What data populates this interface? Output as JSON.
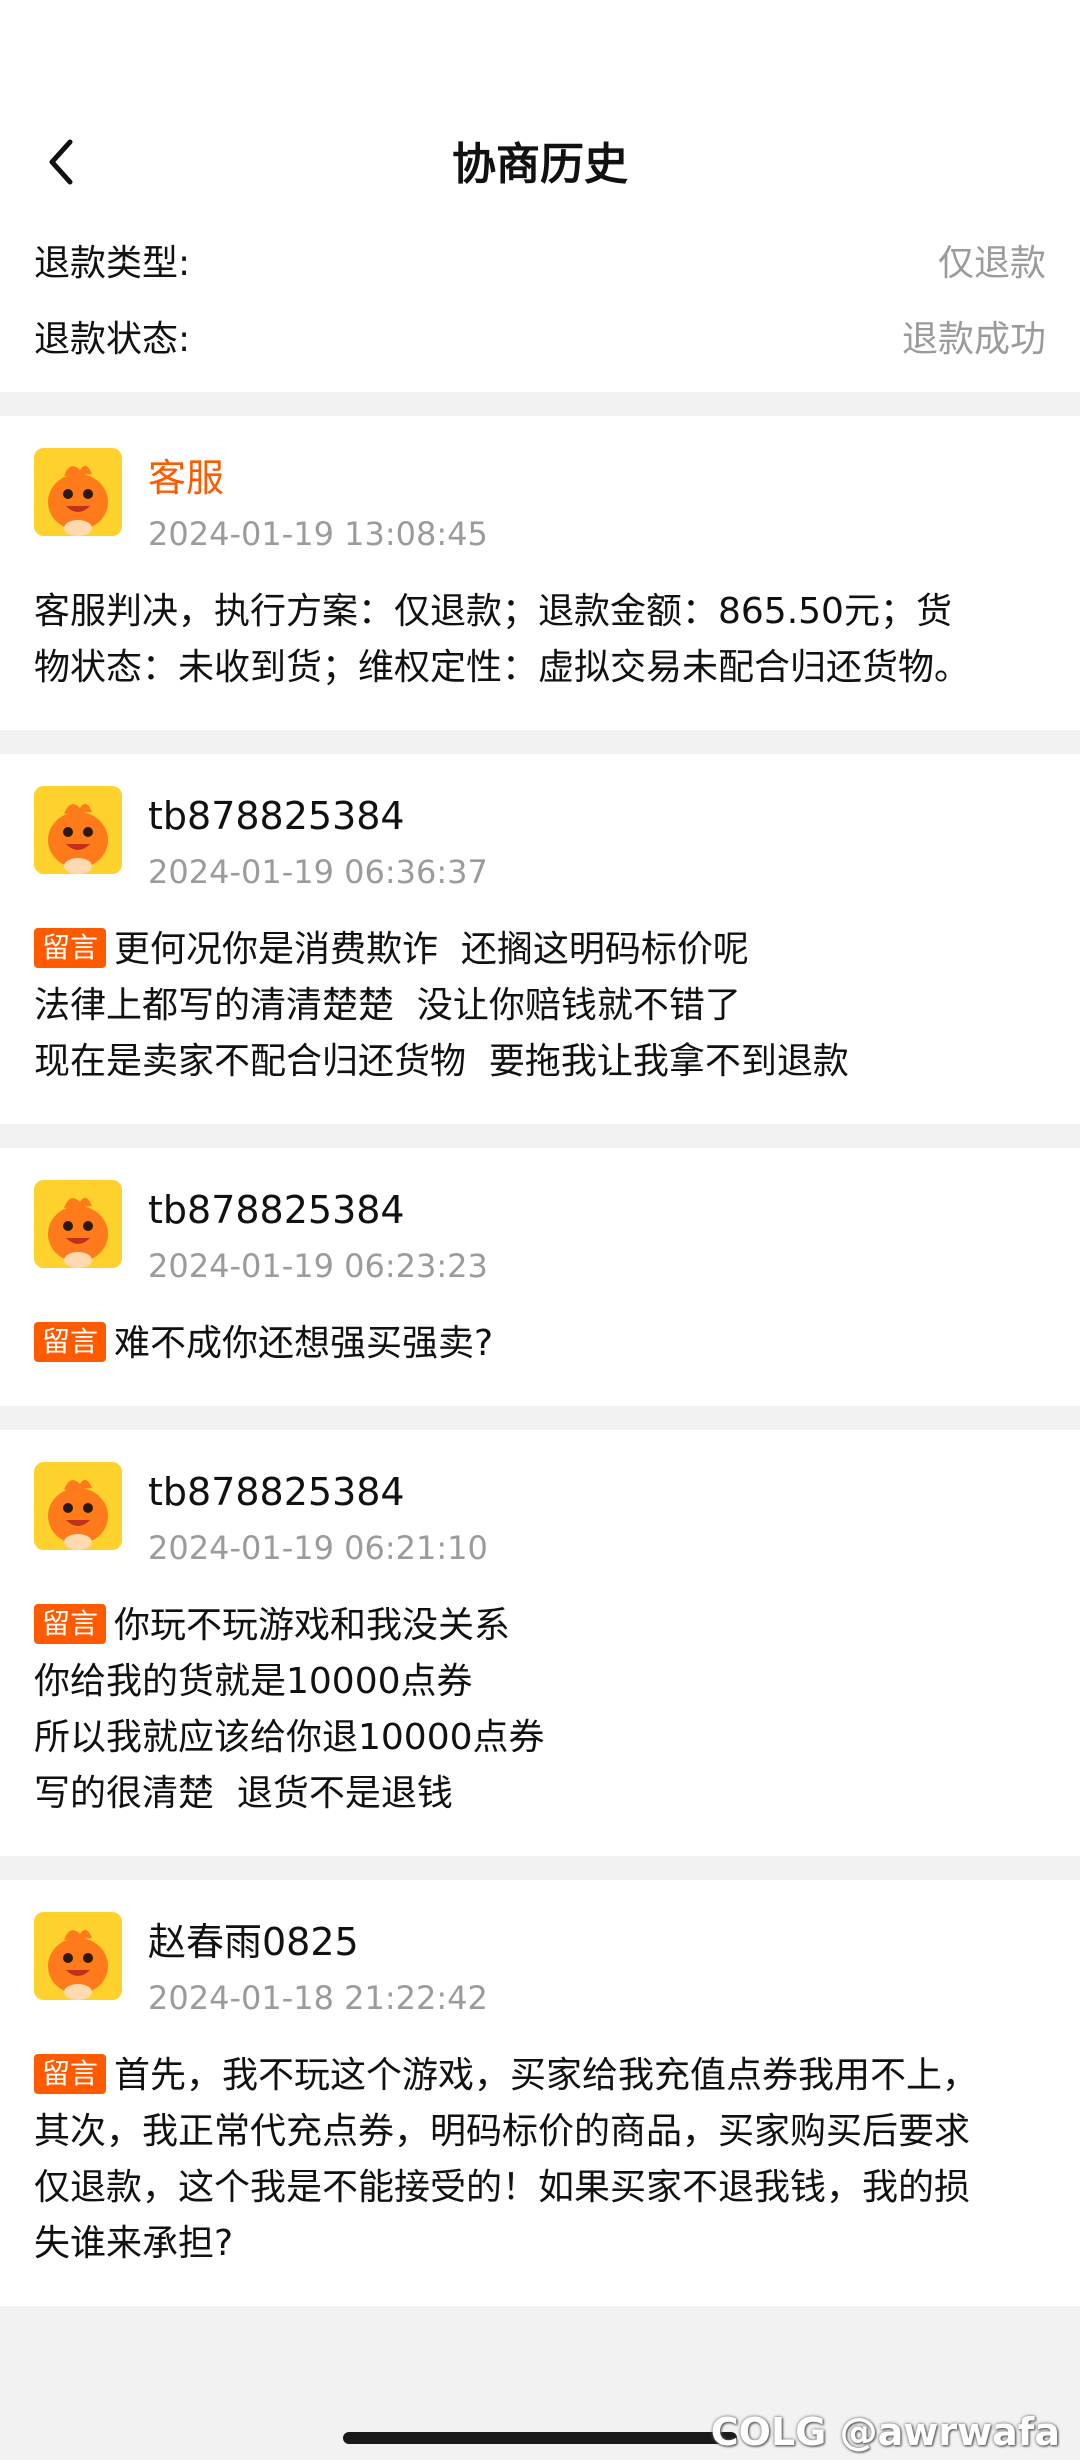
{
  "nav": {
    "title": "协商历史"
  },
  "info": {
    "refund_type_label": "退款类型:",
    "refund_type_value": "仅退款",
    "refund_status_label": "退款状态:",
    "refund_status_value": "退款成功"
  },
  "tag_label": "留言",
  "records": [
    {
      "name": "客服",
      "time": "2024-01-19 13:08:45",
      "lines": [
        "客服判决，执行方案：仅退款；退款金额：865.50元；货",
        "物状态：未收到货；维权定性：虚拟交易未配合归还货物。"
      ]
    },
    {
      "name": "tb878825384",
      "time": "2024-01-19 06:36:37",
      "lines": [
        "更何况你是消费欺诈  还搁这明码标价呢",
        "法律上都写的清清楚楚  没让你赔钱就不错了",
        "现在是卖家不配合归还货物  要拖我让我拿不到退款"
      ]
    },
    {
      "name": "tb878825384",
      "time": "2024-01-19 06:23:23",
      "lines": [
        "难不成你还想强买强卖?"
      ]
    },
    {
      "name": "tb878825384",
      "time": "2024-01-19 06:21:10",
      "lines": [
        "你玩不玩游戏和我没关系",
        "你给我的货就是10000点券",
        "所以我就应该给你退10000点券",
        "写的很清楚  退货不是退钱"
      ]
    },
    {
      "name": "赵春雨0825",
      "time": "2024-01-18 21:22:42",
      "lines": [
        "首先，我不玩这个游戏，买家给我充值点券我用不上，",
        "其次，我正常代充点券，明码标价的商品，买家购买后要求",
        "仅退款，这个我是不能接受的！如果买家不退我钱，我的损",
        "失谁来承担?"
      ]
    }
  ],
  "watermark": "COLG @awrwafa",
  "colors": {
    "accent": "#ff5a00",
    "avatar_bg": "#ffd12d",
    "secondary_text": "#9b9b9b",
    "page_bg": "#f2f2f2"
  }
}
